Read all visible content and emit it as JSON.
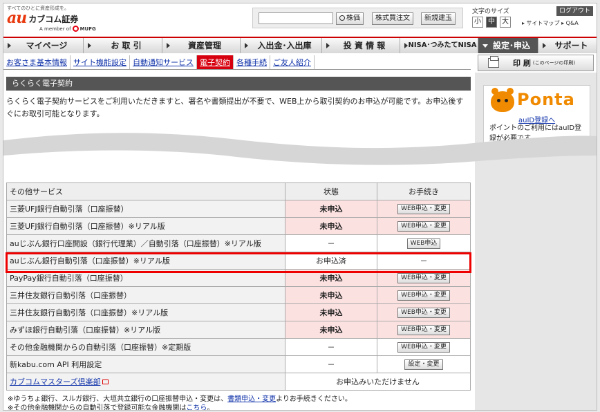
{
  "header": {
    "tagline": "すべてのひとに資産形成を。",
    "logo_au": "au",
    "logo_name": "カブコム証券",
    "member_prefix": "A member of",
    "member_brand": "MUFG",
    "search_placeholder": "",
    "btn_stock_price": "株価",
    "btn_stock_order": "株式買注文",
    "btn_new_margin": "新規建玉",
    "font_size_label": "文字のサイズ",
    "font_small": "小",
    "font_medium": "中",
    "font_large": "大",
    "logout": "ログアウト",
    "sitemap": "▸ サイトマップ ▸ Q&A"
  },
  "gnav": [
    {
      "label": "マイページ"
    },
    {
      "label": "お 取 引"
    },
    {
      "label": "資産管理"
    },
    {
      "label": "入出金･入出庫"
    },
    {
      "label": "投 資 情 報"
    },
    {
      "label": "NISA･つみたてNISA"
    },
    {
      "label": "設定･申込"
    },
    {
      "label": "サポート"
    }
  ],
  "subnav": [
    {
      "label": "お客さま基本情報"
    },
    {
      "label": "サイト機能設定"
    },
    {
      "label": "自動通知サービス"
    },
    {
      "label": "電子契約"
    },
    {
      "label": "各種手続"
    },
    {
      "label": "ご友人紹介"
    }
  ],
  "print": {
    "label": "印 刷",
    "note": "(このページの印刷)"
  },
  "section": {
    "title": "らくらく電子契約",
    "intro": "らくらく電子契約サービスをご利用いただきますと、署名や書類提出が不要で、WEB上から取引契約のお申込が可能です。お申込後すぐにお取引可能となります。"
  },
  "ponta": {
    "brand": "Ponta",
    "link": "auID登録へ",
    "desc": "ポイントのご利用にはauID登録が必要です。"
  },
  "table": {
    "headers": {
      "service": "その他サービス",
      "status": "状態",
      "procedure": "お手続き"
    },
    "rows": [
      {
        "name": "三菱UFJ銀行自動引落（口座振替）",
        "status": "未申込",
        "procedure": "WEB申込・変更"
      },
      {
        "name": "三菱UFJ銀行自動引落（口座振替）※リアル版",
        "status": "未申込",
        "procedure": "WEB申込・変更"
      },
      {
        "name": "auじぶん銀行口座開設（銀行代理業）／自動引落（口座振替）※リアル版",
        "status": "－",
        "procedure": "WEB申込"
      },
      {
        "name": "auじぶん銀行自動引落（口座振替）※リアル版",
        "status": "お申込済",
        "procedure": "－"
      },
      {
        "name": "PayPay銀行自動引落（口座振替）",
        "status": "未申込",
        "procedure": "WEB申込・変更"
      },
      {
        "name": "三井住友銀行自動引落（口座振替）",
        "status": "未申込",
        "procedure": "WEB申込・変更"
      },
      {
        "name": "三井住友銀行自動引落（口座振替）※リアル版",
        "status": "未申込",
        "procedure": "WEB申込・変更"
      },
      {
        "name": "みずほ銀行自動引落（口座振替）※リアル版",
        "status": "未申込",
        "procedure": "WEB申込・変更"
      },
      {
        "name": "その他金融機関からの自動引落（口座振替）※定期版",
        "status": "－",
        "procedure": "WEB申込・変更"
      },
      {
        "name": "新kabu.com API 利用設定",
        "status": "－",
        "procedure": "設定・変更"
      }
    ],
    "club": {
      "name": "カブコムマスターズ倶楽部",
      "note": "お申込みいただけません"
    }
  },
  "notes": {
    "line1_pre": "※ゆうちょ銀行、スルガ銀行、大垣共立銀行の口座振替申込・変更は、",
    "line1_link": "書類申込・変更",
    "line1_post": "よりお手続きください。",
    "line2_pre": "※その他金融機関からの自動引落で登録可能な金融機関は",
    "line2_link": "こちら",
    "line2_post": "。"
  },
  "colors": {
    "accent": "#d7000f",
    "brand": "#e8380d",
    "ponta": "#f08a00",
    "highlight": "#ee0000",
    "row_pink": "#fce1e1"
  }
}
